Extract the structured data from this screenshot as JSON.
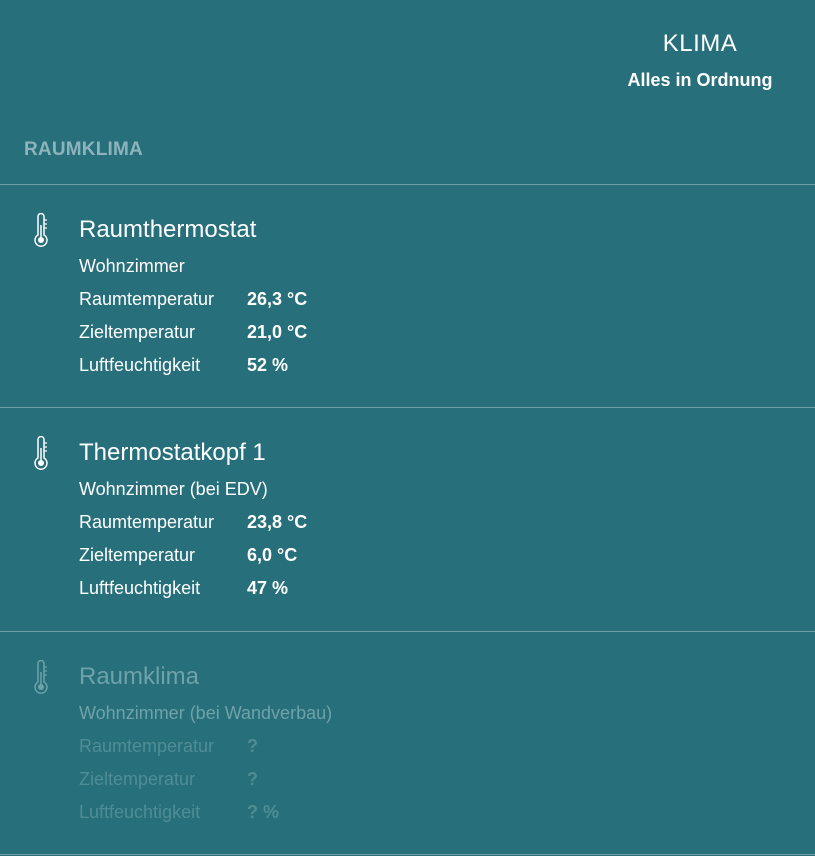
{
  "header": {
    "title": "KLIMA",
    "status": "Alles in Ordnung"
  },
  "section": {
    "heading": "RAUMKLIMA"
  },
  "devices": [
    {
      "icon": "thermometer-icon",
      "title": "Raumthermostat",
      "room": "Wohnzimmer",
      "rows": [
        {
          "label": "Raumtemperatur",
          "value": "26,3 °C"
        },
        {
          "label": "Zieltemperatur",
          "value": "21,0 °C"
        },
        {
          "label": "Luftfeuchtigkeit",
          "value": "52 %"
        }
      ]
    },
    {
      "icon": "thermometer-icon",
      "title": "Thermostatkopf 1",
      "room": "Wohnzimmer (bei EDV)",
      "rows": [
        {
          "label": "Raumtemperatur",
          "value": "23,8 °C"
        },
        {
          "label": "Zieltemperatur",
          "value": "6,0 °C"
        },
        {
          "label": "Luftfeuchtigkeit",
          "value": "47 %"
        }
      ]
    },
    {
      "icon": "thermometer-icon",
      "title": "Raumklima",
      "room": "Wohnzimmer (bei Wandverbau)",
      "rows": [
        {
          "label": "Raumtemperatur",
          "value": "?"
        },
        {
          "label": "Zieltemperatur",
          "value": "?"
        },
        {
          "label": "Luftfeuchtigkeit",
          "value": "? %"
        }
      ]
    }
  ],
  "colors": {
    "background": "#276f7a",
    "text": "#ffffff",
    "section_heading": "#8fb3ba",
    "divider": "#6f9ea6",
    "inactive_text": "#5f979f"
  }
}
